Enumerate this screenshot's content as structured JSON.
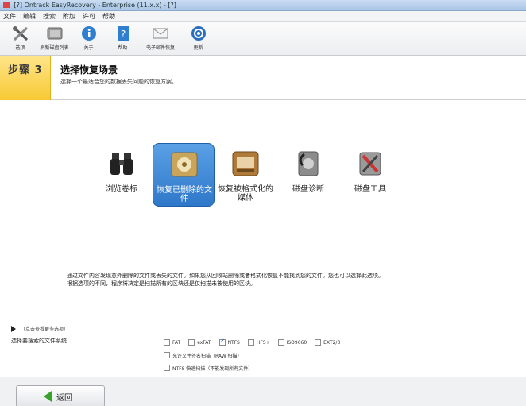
{
  "window": {
    "title": "[?] Ontrack EasyRecovery - Enterprise (11.x.x) - [?]"
  },
  "menu": [
    "文件",
    "编辑",
    "搜索",
    "附加",
    "许可",
    "帮助"
  ],
  "toolbar": [
    {
      "label": "选项",
      "icon": "tools-icon"
    },
    {
      "label": "刷新磁盘列表",
      "icon": "disk-refresh-icon"
    },
    {
      "label": "关于",
      "icon": "info-icon"
    },
    {
      "label": "帮助",
      "icon": "help-icon"
    },
    {
      "label": "电子邮件恢复",
      "icon": "email-icon"
    },
    {
      "label": "更新",
      "icon": "update-icon"
    }
  ],
  "step": {
    "badge": "步骤 3",
    "title": "选择恢复场景",
    "subtitle": "选择一个最适合您的数据丢失问题的恢复方案。"
  },
  "scenarios": [
    {
      "label": "浏览卷标",
      "icon": "binoculars-icon",
      "selected": false
    },
    {
      "label": "恢复已删除的文件",
      "icon": "deleted-file-recovery-icon",
      "selected": true
    },
    {
      "label": "恢复被格式化的媒体",
      "icon": "format-recovery-icon",
      "selected": false
    },
    {
      "label": "磁盘诊断",
      "icon": "disk-diagnostic-icon",
      "selected": false
    },
    {
      "label": "磁盘工具",
      "icon": "disk-tools-icon",
      "selected": false
    }
  ],
  "description": {
    "line1": "通过文件内容发现意外删除的文件或丢失的文件。如果您从回收站删除或者格式化恢复不能找到您的文件。您也可以选择此选项。",
    "line2": "根据选项的不同，程序将决定是扫描所有的区块还是仅扫描未被使用的区块。"
  },
  "more_options": "（点击查看更多选项）",
  "filesystem_label": "选择要搜索的文件系统",
  "filesystems": [
    {
      "label": "FAT",
      "checked": false
    },
    {
      "label": "exFAT",
      "checked": false
    },
    {
      "label": "NTFS",
      "checked": true
    },
    {
      "label": "HFS+",
      "checked": false
    },
    {
      "label": "ISO9660",
      "checked": false
    },
    {
      "label": "EXT2/3",
      "checked": false
    }
  ],
  "options": [
    {
      "label": "允许文件签名扫描（RAW 扫描）",
      "checked": false
    },
    {
      "label": "NTFS 快速扫描（不能发现所有文件）",
      "checked": false
    }
  ],
  "footer": {
    "back_label": "返回"
  },
  "colors": {
    "step_badge": "#f7c934",
    "selected_tile": "#3f87d6",
    "back_arrow": "#3aa12a"
  }
}
